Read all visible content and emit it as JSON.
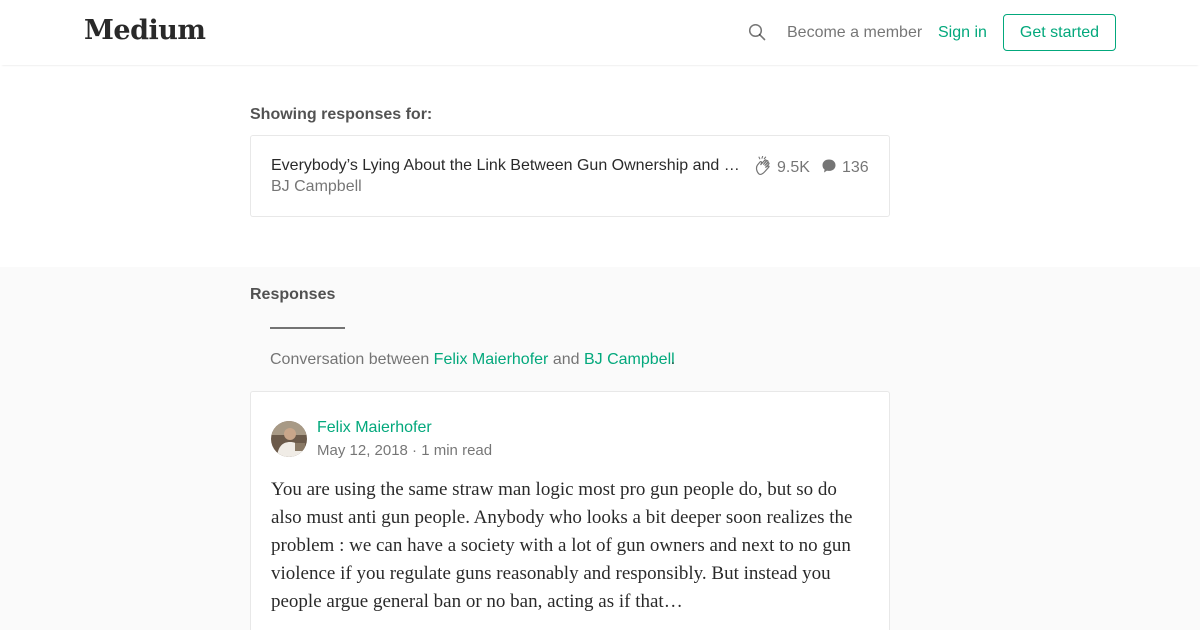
{
  "header": {
    "logo": "Medium",
    "search_icon": "search-icon",
    "become_member": "Become a member",
    "sign_in": "Sign in",
    "get_started": "Get started",
    "accent_color": "#03a87c"
  },
  "showing": {
    "label": "Showing responses for:",
    "story": {
      "title": "Everybody’s Lying About the Link Between Gun Ownership and Homicide",
      "author": "BJ Campbell",
      "claps": "9.5K",
      "comments": "136",
      "clap_icon": "clap-icon",
      "comment_icon": "comment-bubble-icon"
    }
  },
  "responses": {
    "heading": "Responses",
    "conversation": {
      "prefix": "Conversation between",
      "person1": "Felix Maierhofer",
      "joiner": "and",
      "person2": "BJ Campbell",
      "suffix": "."
    },
    "items": [
      {
        "author": "Felix Maierhofer",
        "meta": "May 12, 2018 · 1 min read",
        "body": "You are using the same straw man logic most pro gun people do, but so do also must anti gun people. Anybody who looks a bit deeper soon realizes the problem : we can have a society with a lot of gun owners and next to no gun violence if you regulate guns reasonably and responsibly. But instead you people argue general ban or no ban, acting as if that…"
      }
    ]
  }
}
